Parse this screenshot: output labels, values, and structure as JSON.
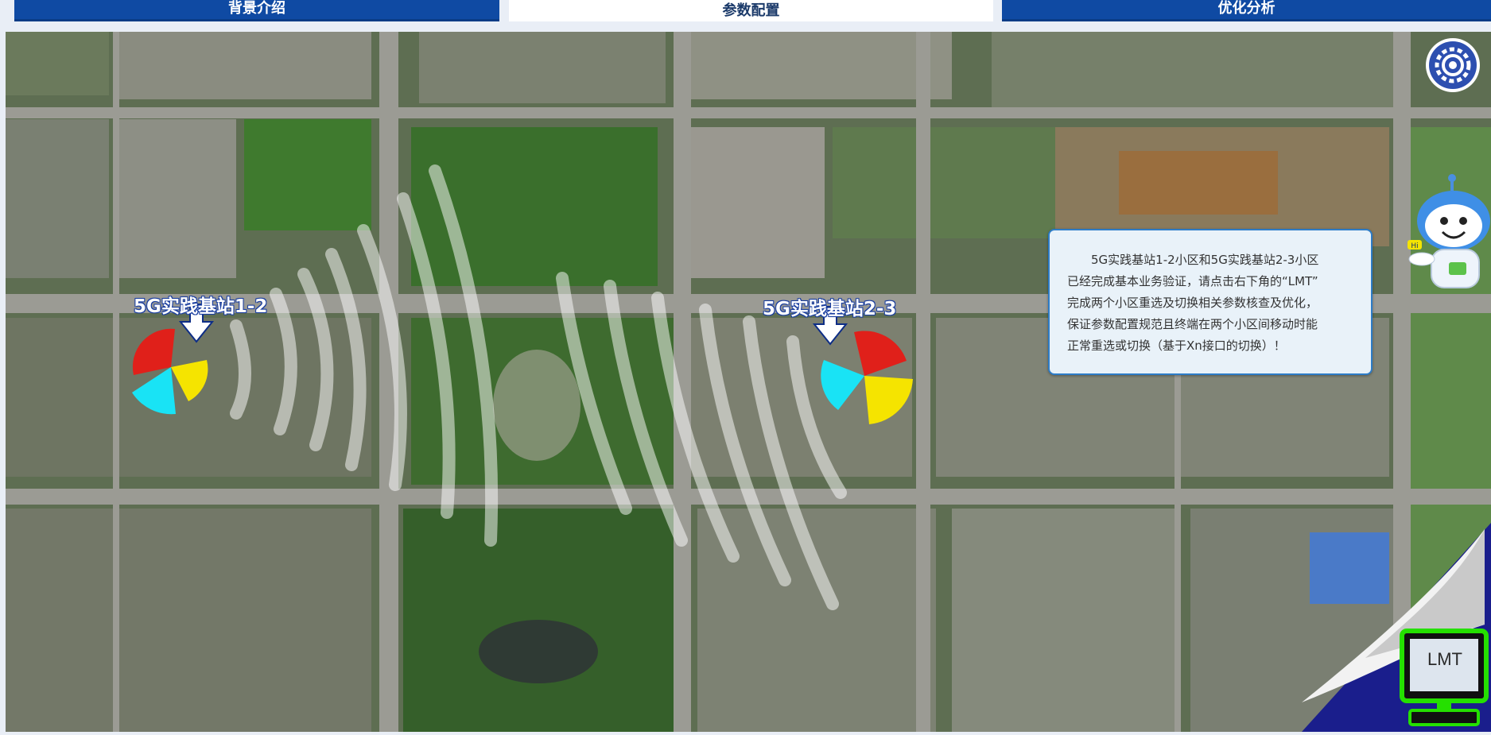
{
  "tabs": [
    {
      "label": "背景介绍",
      "active": false
    },
    {
      "label": "参数配置",
      "active": true
    },
    {
      "label": "优化分析",
      "active": false
    }
  ],
  "sites": {
    "site_a": "5G实践基站1-2",
    "site_b": "5G实践基站2-3"
  },
  "message": {
    "line1": "5G实践基站1-2小区和5G实践基站2-3小区",
    "line2": "已经完成基本业务验证，请点击右下角的“LMT”",
    "line3": "完成两个小区重选及切换相关参数核查及优化，",
    "line4": "保证参数配置规范且终端在两个小区间移动时能",
    "line5": "正常重选或切换（基于Xn接口的切换）！"
  },
  "robot": {
    "badge": "Hi"
  },
  "lmt": {
    "label": "LMT"
  },
  "icons": {
    "settings": "gear-icon",
    "assistant": "robot-icon",
    "terminal": "computer-icon",
    "signal": "signal-wave-icon",
    "pointer": "arrow-down-icon"
  },
  "colors": {
    "tab_blue": "#0f4aa3",
    "sector_red": "#e0201a",
    "sector_yellow": "#f5e400",
    "sector_cyan": "#19e3f5",
    "lmt_green": "#25e000"
  }
}
